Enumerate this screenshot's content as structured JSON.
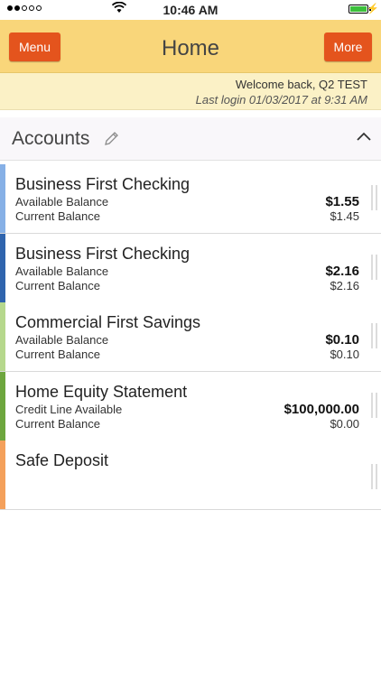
{
  "status": {
    "time": "10:46 AM",
    "signal_icon": "signal-dots-icon",
    "wifi_icon": "wifi-icon",
    "battery_icon": "battery-icon"
  },
  "header": {
    "menu_label": "Menu",
    "title": "Home",
    "more_label": "More",
    "accent": "#e4541d",
    "bg": "#f9d67a"
  },
  "welcome": {
    "greeting": "Welcome back, Q2 TEST",
    "last_login": "Last login 01/03/2017 at 9:31 AM"
  },
  "accounts": {
    "title": "Accounts",
    "edit_icon": "pencil-icon",
    "collapse_icon": "chevron-up-icon",
    "items": [
      {
        "name": "Business First Checking",
        "label1": "Available Balance",
        "value1": "$1.55",
        "label2": "Current Balance",
        "value2": "$1.45",
        "color": "#86b0e6"
      },
      {
        "name": "Business First Checking",
        "label1": "Available Balance",
        "value1": "$2.16",
        "label2": "Current Balance",
        "value2": "$2.16",
        "color": "#2f64ad"
      },
      {
        "name": "Commercial First Savings",
        "label1": "Available Balance",
        "value1": "$0.10",
        "label2": "Current Balance",
        "value2": "$0.10",
        "color": "#b6d88d"
      },
      {
        "name": "Home Equity Statement",
        "label1": "Credit Line Available",
        "value1": "$100,000.00",
        "label2": "Current Balance",
        "value2": "$0.00",
        "color": "#6da63e"
      },
      {
        "name": "Safe Deposit",
        "label1": "",
        "value1": "",
        "label2": "",
        "value2": "",
        "color": "#f4a05b"
      }
    ]
  }
}
